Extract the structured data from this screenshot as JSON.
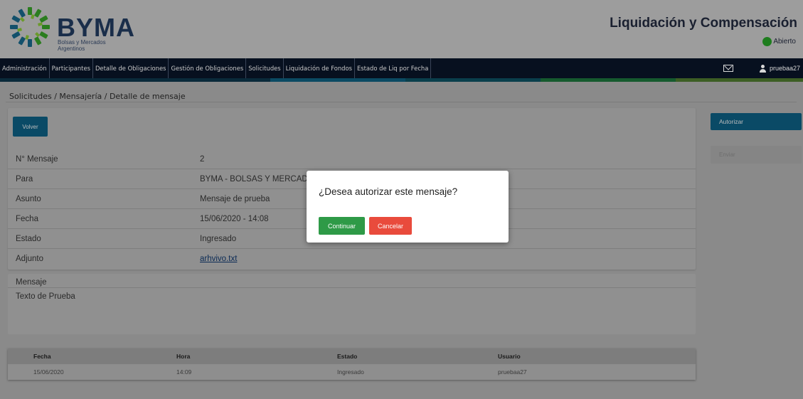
{
  "header": {
    "brand": "BYMA",
    "brand_sub": "Bolsas y Mercados Argentinos",
    "app_title": "Liquidación y Compensación",
    "status": "Abierto"
  },
  "nav": {
    "items": [
      "Administración",
      "Participantes",
      "Detalle de Obligaciones",
      "Gestión de Obligaciones",
      "Solicitudes",
      "Liquidación de Fondos",
      "Estado de Liq por Fecha"
    ],
    "user": "pruebaa27"
  },
  "breadcrumb": "Solicitudes / Mensajería / Detalle de mensaje",
  "buttons": {
    "volver": "Volver",
    "autorizar": "Autorizar",
    "enviar": "Enviar"
  },
  "details": [
    {
      "label": "N° Mensaje",
      "value": "2"
    },
    {
      "label": "Para",
      "value": "BYMA - BOLSAS Y MERCADO"
    },
    {
      "label": "Asunto",
      "value": "Mensaje de prueba"
    },
    {
      "label": "Fecha",
      "value": "15/06/2020 - 14:08"
    },
    {
      "label": "Estado",
      "value": "Ingresado"
    },
    {
      "label": "Adjunto",
      "value": "arhvivo.txt"
    }
  ],
  "mensaje": {
    "title": "Mensaje",
    "body": "Texto de Prueba"
  },
  "table": {
    "headers": [
      "Fecha",
      "Hora",
      "Estado",
      "Usuario"
    ],
    "rows": [
      [
        "15/06/2020",
        "14:09",
        "Ingresado",
        "pruebaa27"
      ]
    ]
  },
  "modal": {
    "question": "¿Desea autorizar este mensaje?",
    "continuar": "Continuar",
    "cancelar": "Cancelar"
  },
  "colors": {
    "accent": "#0a4a66",
    "success": "#2e9a47",
    "danger": "#e94b3c",
    "status_open": "#1e7d1e"
  }
}
